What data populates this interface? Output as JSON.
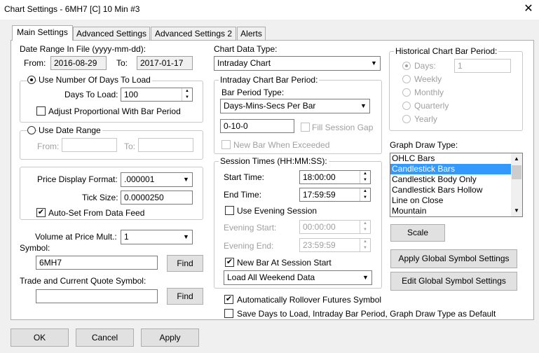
{
  "window": {
    "title": "Chart Settings - 6MH7 [C]  10 Min  #3",
    "close": "✕"
  },
  "tabs": [
    "Main Settings",
    "Advanced Settings",
    "Advanced Settings 2",
    "Alerts"
  ],
  "date_range": {
    "label": "Date Range In File (yyyy-mm-dd):",
    "from_label": "From:",
    "from": "2016-08-29",
    "to_label": "To:",
    "to": "2017-01-17"
  },
  "days": {
    "use_label": "Use Number Of Days To Load",
    "days_label": "Days To Load:",
    "days_value": "100",
    "adjust_label": "Adjust Proportional With Bar Period"
  },
  "date_range_opt": {
    "label": "Use Date Range",
    "from_label": "From:",
    "to_label": "To:"
  },
  "price": {
    "format_label": "Price Display Format:",
    "format_value": ".000001",
    "tick_label": "Tick Size:",
    "tick_value": "0.0000250",
    "autoset_label": "Auto-Set From Data Feed"
  },
  "volume": {
    "label": "Volume at Price Mult.:",
    "value": "1"
  },
  "symbol": {
    "label": "Symbol:",
    "value": "6MH7",
    "find": "Find"
  },
  "trade_symbol": {
    "label": "Trade and Current Quote Symbol:",
    "value": "",
    "find": "Find"
  },
  "chart_data": {
    "label": "Chart Data Type:",
    "value": "Intraday Chart"
  },
  "intraday": {
    "group": "Intraday Chart Bar Period:",
    "type_label": "Bar Period Type:",
    "type_value": "Days-Mins-Secs Per Bar",
    "period": "0-10-0",
    "fill_gap": "Fill Session Gap",
    "new_bar": "New Bar When Exceeded"
  },
  "session": {
    "group": "Session Times (HH:MM:SS):",
    "start_label": "Start Time:",
    "start": "18:00:00",
    "end_label": "End Time:",
    "end": "17:59:59",
    "evening_label": "Use Evening Session",
    "ev_start_label": "Evening Start:",
    "ev_start": "00:00:00",
    "ev_end_label": "Evening End:",
    "ev_end": "23:59:59",
    "new_bar_label": "New Bar At Session Start",
    "weekend": "Load All Weekend Data"
  },
  "rollover": "Automatically Rollover Futures Symbol",
  "save_default": "Save Days to Load, Intraday Bar Period, Graph Draw Type as Default",
  "historical": {
    "group": "Historical Chart Bar Period:",
    "options": [
      "Days:",
      "Weekly",
      "Monthly",
      "Quarterly",
      "Yearly"
    ],
    "days_value": "1"
  },
  "graph": {
    "label": "Graph Draw Type:",
    "items": [
      "OHLC Bars",
      "Candlestick Bars",
      "Candlestick Body Only",
      "Candlestick Bars Hollow",
      "Line on Close",
      "Mountain"
    ],
    "selected": "Candlestick Bars"
  },
  "buttons": {
    "scale": "Scale",
    "apply_global": "Apply Global Symbol Settings",
    "edit_global": "Edit Global Symbol Settings",
    "ok": "OK",
    "cancel": "Cancel",
    "apply": "Apply"
  },
  "check": "✔",
  "arrows": {
    "down": "▼",
    "up": "▲",
    "spin_up": "▲",
    "spin_down": "▼"
  }
}
